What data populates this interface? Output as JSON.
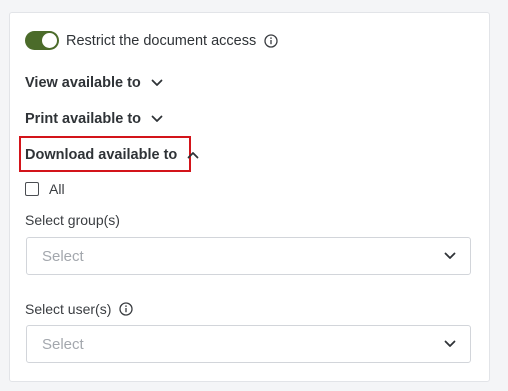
{
  "restrict": {
    "label": "Restrict the document access",
    "enabled": true,
    "toggle_color": "#4b6b2a"
  },
  "sections": {
    "view": {
      "label": "View available to",
      "expanded": false
    },
    "print": {
      "label": "Print available to",
      "expanded": false
    },
    "download": {
      "label": "Download available to",
      "expanded": true
    }
  },
  "download_panel": {
    "all_label": "All",
    "all_checked": false,
    "groups_label": "Select group(s)",
    "groups_placeholder": "Select",
    "users_label": "Select user(s)",
    "users_placeholder": "Select"
  },
  "colors": {
    "highlight": "#d3141a",
    "toggle_on": "#4b6b2a"
  },
  "icons": {
    "info": "info-circle-icon",
    "chevron_down": "chevron-down-icon",
    "chevron_up": "chevron-up-icon"
  }
}
